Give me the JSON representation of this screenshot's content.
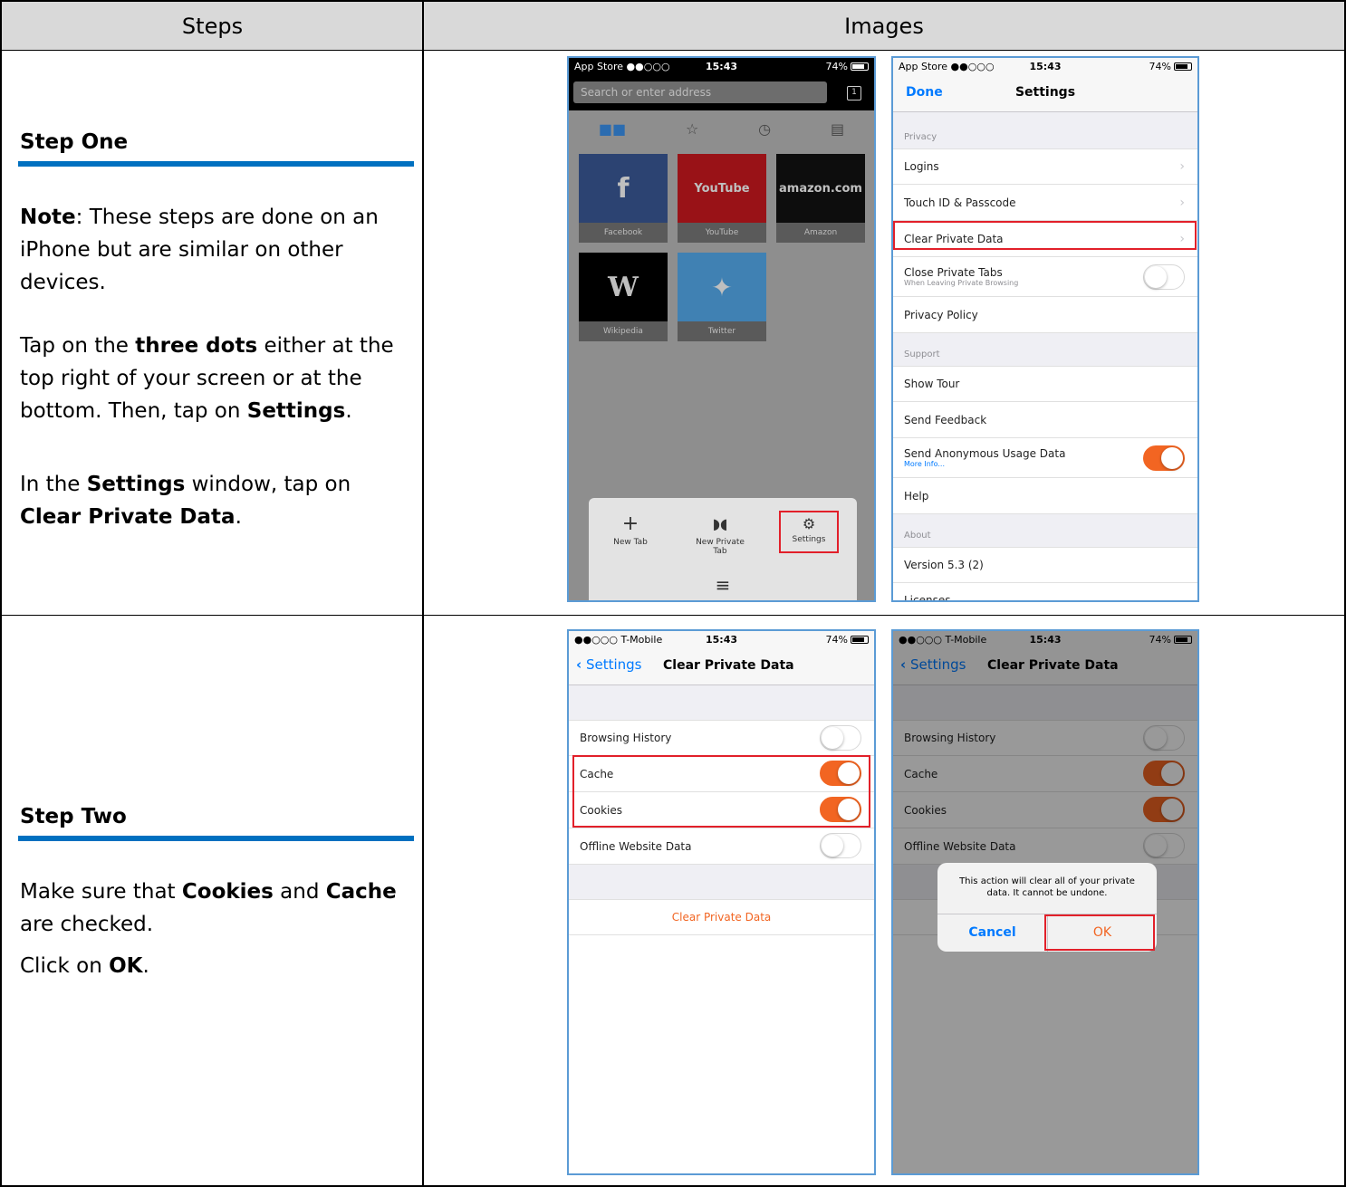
{
  "table": {
    "header_steps": "Steps",
    "header_images": "Images"
  },
  "step_one": {
    "title": "Step One",
    "note_label": "Note",
    "note_text": ": These steps are done on an iPhone but are similar on other devices.",
    "p2_a": "Tap on the ",
    "p2_b": "three dots",
    "p2_c": " either at the top right of your screen or at the bottom. Then, tap on ",
    "p2_d": "Settings",
    "p2_e": ".",
    "p3_a": "In the ",
    "p3_b": "Settings",
    "p3_c": " window, tap on ",
    "p3_d": "Clear Private Data",
    "p3_e": "."
  },
  "step_two": {
    "title": "Step Two",
    "p1_a": "Make sure that ",
    "p1_b": "Cookies",
    "p1_c": " and ",
    "p1_d": "Cache",
    "p1_e": " are checked.",
    "p2_a": "Click on ",
    "p2_b": "OK",
    "p2_c": "."
  },
  "phone1": {
    "status_left": "App Store ●●○○○",
    "status_time": "15:43",
    "status_right": "74%",
    "search_placeholder": "Search or enter address",
    "tab_count": "1",
    "sites": [
      {
        "label": "Facebook",
        "logo": "f",
        "color": "#3b5998"
      },
      {
        "label": "YouTube",
        "logo": "YouTube",
        "color": "#cc181e"
      },
      {
        "label": "Amazon",
        "logo": "amazon.com",
        "color": "#111111"
      },
      {
        "label": "Wikipedia",
        "logo": "W",
        "color": "#000000"
      },
      {
        "label": "Twitter",
        "logo": "twitter-bird-icon",
        "color": "#55acee"
      }
    ],
    "menu": {
      "new_tab": "New Tab",
      "new_private_tab": "New Private Tab",
      "settings": "Settings"
    }
  },
  "phone2": {
    "status_left": "App Store ●●○○○",
    "status_time": "15:43",
    "status_right": "74%",
    "done": "Done",
    "title": "Settings",
    "sec_privacy": "Privacy",
    "logins": "Logins",
    "touch_id": "Touch ID & Passcode",
    "clear_private_data": "Clear Private Data",
    "close_private_tabs": "Close Private Tabs",
    "close_private_tabs_sub": "When Leaving Private Browsing",
    "privacy_policy": "Privacy Policy",
    "sec_support": "Support",
    "show_tour": "Show Tour",
    "send_feedback": "Send Feedback",
    "send_usage": "Send Anonymous Usage Data",
    "more_info": "More Info...",
    "help": "Help",
    "sec_about": "About",
    "version": "Version 5.3 (2)",
    "licenses": "Licenses",
    "close_private_tabs_on": false,
    "send_usage_on": true
  },
  "phone3": {
    "status_left": "●●○○○ T-Mobile",
    "status_time": "15:43",
    "status_right": "74%",
    "back": "Settings",
    "title": "Clear Private Data",
    "browsing_history": "Browsing History",
    "cache": "Cache",
    "cookies": "Cookies",
    "offline_data": "Offline Website Data",
    "clear_button": "Clear Private Data",
    "browsing_history_on": false,
    "cache_on": true,
    "cookies_on": true,
    "offline_on": false
  },
  "phone4": {
    "status_left": "●●○○○ T-Mobile",
    "status_time": "15:43",
    "status_right": "74%",
    "back": "Settings",
    "title": "Clear Private Data",
    "browsing_history": "Browsing History",
    "cache": "Cache",
    "cookies": "Cookies",
    "offline_data": "Offline Website Data",
    "alert_message": "This action will clear all of your private data. It cannot be undone.",
    "cancel": "Cancel",
    "ok": "OK"
  },
  "colors": {
    "accent_blue": "#0070c0",
    "ios_blue": "#007aff",
    "toggle_orange": "#f26522",
    "highlight_red": "#e2202a",
    "frame_blue": "#5b9bd5"
  }
}
